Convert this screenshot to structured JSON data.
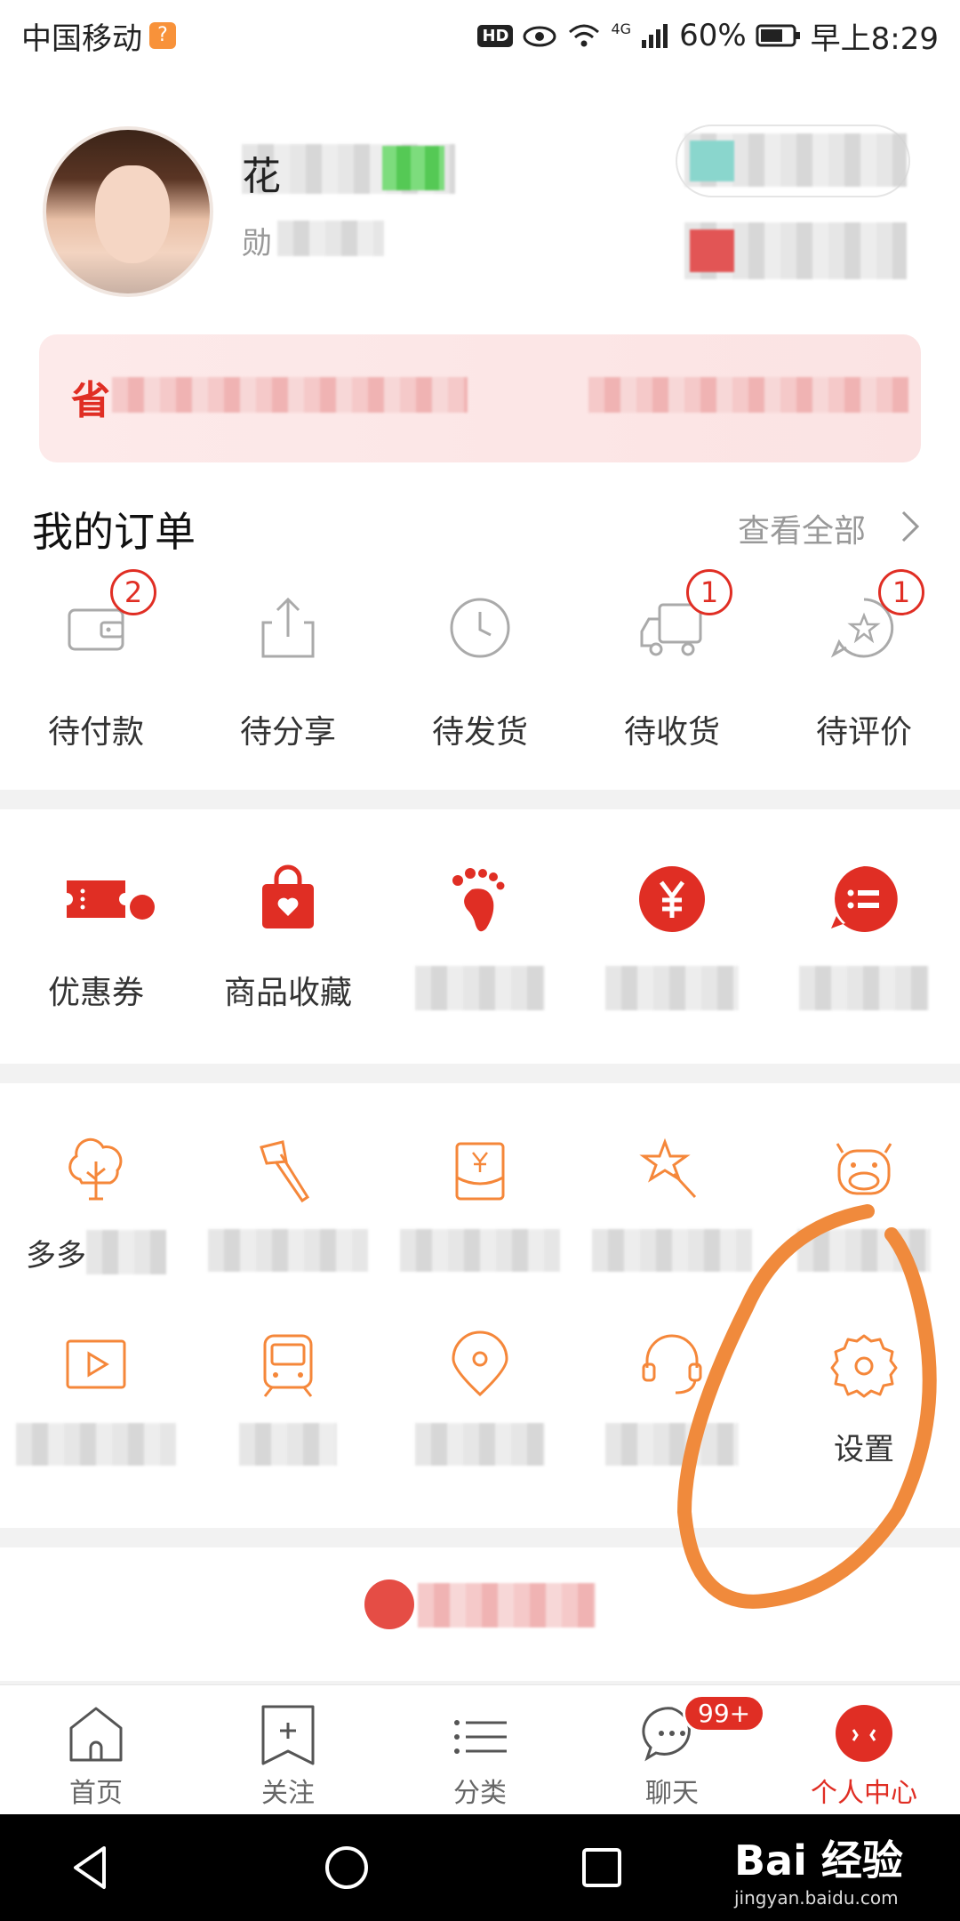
{
  "status_bar": {
    "carrier": "中国移动",
    "sim_badge": "?",
    "hd": "HD",
    "network": "4G",
    "battery": "60%",
    "time": "早上8:29"
  },
  "header": {
    "name_visible": "花",
    "sub_visible": "勋",
    "save_label": "省"
  },
  "orders": {
    "title": "我的订单",
    "view_all": "查看全部",
    "items": [
      {
        "label": "待付款",
        "badge": "2",
        "icon": "wallet-icon"
      },
      {
        "label": "待分享",
        "badge": "",
        "icon": "share-icon"
      },
      {
        "label": "待发货",
        "badge": "",
        "icon": "clock-icon"
      },
      {
        "label": "待收货",
        "badge": "1",
        "icon": "truck-icon"
      },
      {
        "label": "待评价",
        "badge": "1",
        "icon": "review-icon"
      }
    ]
  },
  "tools": [
    {
      "label": "优惠券",
      "icon": "coupon-icon",
      "dot": true
    },
    {
      "label": "商品收藏",
      "icon": "favorite-bag-icon",
      "dot": false
    },
    {
      "label": "",
      "icon": "footprint-icon",
      "dot": false
    },
    {
      "label": "",
      "icon": "yuan-icon",
      "dot": false
    },
    {
      "label": "",
      "icon": "list-bubble-icon",
      "dot": false
    }
  ],
  "services_row1": [
    {
      "label": "多多",
      "icon": "tree-icon"
    },
    {
      "label": "",
      "icon": "axe-icon"
    },
    {
      "label": "",
      "icon": "red-envelope-icon"
    },
    {
      "label": "",
      "icon": "magic-wand-icon"
    },
    {
      "label": "",
      "icon": "cow-icon"
    }
  ],
  "services_row2": [
    {
      "label": "",
      "icon": "video-icon"
    },
    {
      "label": "",
      "icon": "train-icon"
    },
    {
      "label": "",
      "icon": "location-icon"
    },
    {
      "label": "",
      "icon": "headset-icon"
    },
    {
      "label": "设置",
      "icon": "settings-gear-icon"
    }
  ],
  "tabbar": [
    {
      "label": "首页",
      "icon": "home-icon",
      "active": false
    },
    {
      "label": "关注",
      "icon": "follow-icon",
      "active": false
    },
    {
      "label": "分类",
      "icon": "category-icon",
      "active": false
    },
    {
      "label": "聊天",
      "icon": "chat-icon",
      "active": false,
      "badge": "99+"
    },
    {
      "label": "个人中心",
      "icon": "profile-icon",
      "active": true
    }
  ],
  "watermark": {
    "title": "Bai 经验",
    "url": "jingyan.baidu.com"
  },
  "colors": {
    "brand_red": "#e02e24",
    "accent_orange": "#f5873a",
    "annotation_orange": "#f08a3c"
  }
}
